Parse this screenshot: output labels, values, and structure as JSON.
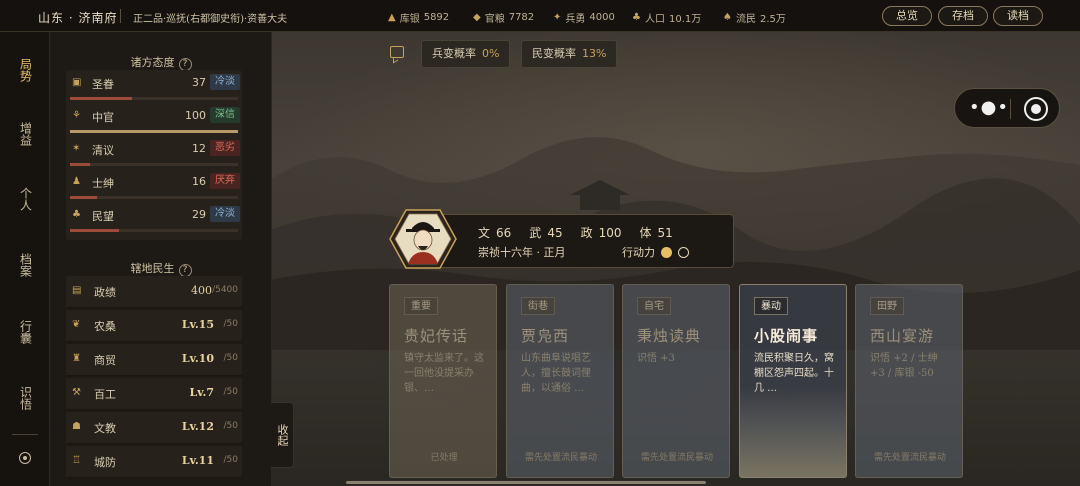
{
  "topbar": {
    "location": "山东 · 济南府",
    "rank": "正二品·巡抚(右都御史衔)·资善大夫",
    "stats": [
      {
        "icon": "treasury-icon",
        "label": "库银",
        "value": "5892"
      },
      {
        "icon": "grain-icon",
        "label": "官粮",
        "value": "7782"
      },
      {
        "icon": "soldier-icon",
        "label": "兵勇",
        "value": "4000"
      },
      {
        "icon": "population-icon",
        "label": "人口",
        "value": "10.1万"
      },
      {
        "icon": "refugee-icon",
        "label": "流民",
        "value": "2.5万"
      }
    ],
    "buttons": {
      "overview": "总览",
      "save": "存档",
      "load": "读档"
    }
  },
  "nav": {
    "items": [
      "局势",
      "增益",
      "个人",
      "档案",
      "行囊",
      "识悟"
    ]
  },
  "attitudes": {
    "title": "诸方态度",
    "help": "?",
    "rows": [
      {
        "icon": "emperor-icon",
        "name": "圣眷",
        "value": "37",
        "tag": "冷淡",
        "level": 0.37
      },
      {
        "icon": "palace-icon",
        "name": "中官",
        "value": "100",
        "tag": "深信",
        "level": 1.0
      },
      {
        "icon": "scholar-icon",
        "name": "清议",
        "value": "12",
        "tag": "恶劣",
        "level": 0.12
      },
      {
        "icon": "gentry-icon",
        "name": "士绅",
        "value": "16",
        "tag": "厌弃",
        "level": 0.16
      },
      {
        "icon": "people-icon",
        "name": "民望",
        "value": "29",
        "tag": "冷淡",
        "level": 0.29
      }
    ]
  },
  "governance": {
    "title": "辖地民生",
    "help": "?",
    "rows": [
      {
        "icon": "merit-icon",
        "name": "政绩",
        "value": "400",
        "max": "/5400"
      },
      {
        "icon": "farm-icon",
        "name": "农桑",
        "value": "Lv.15",
        "max": "/50"
      },
      {
        "icon": "trade-icon",
        "name": "商贸",
        "value": "Lv.10",
        "max": "/50"
      },
      {
        "icon": "craft-icon",
        "name": "百工",
        "value": "Lv.7",
        "max": "/50"
      },
      {
        "icon": "culture-icon",
        "name": "文教",
        "value": "Lv.12",
        "max": "/50"
      },
      {
        "icon": "defense-icon",
        "name": "城防",
        "value": "Lv.11",
        "max": "/50"
      }
    ]
  },
  "collapse_label": "收起",
  "chips": {
    "mutiny": {
      "label": "兵变概率",
      "value": "0%"
    },
    "revolt": {
      "label": "民变概率",
      "value": "13%"
    }
  },
  "character": {
    "attrs": [
      {
        "label": "文",
        "value": "66"
      },
      {
        "label": "武",
        "value": "45"
      },
      {
        "label": "政",
        "value": "100"
      },
      {
        "label": "体",
        "value": "51"
      }
    ],
    "date": "崇祯十六年 · 正月",
    "action_label": "行动力",
    "action_points": 1,
    "action_max": 2
  },
  "events": [
    {
      "tag": "重要",
      "title": "贵妃传话",
      "desc": "镇守太监来了。这一回他没提采办银、…",
      "foot": "已处理",
      "style": "brown"
    },
    {
      "tag": "街巷",
      "title": "贾凫西",
      "desc": "山东曲阜说唱艺人，擅长鼓词俚曲，以通俗 …",
      "foot": "需先处置流民暴动",
      "style": "blue"
    },
    {
      "tag": "自宅",
      "title": "秉烛读典",
      "desc": "识悟 +3",
      "foot": "需先处置流民暴动",
      "style": "blue"
    },
    {
      "tag": "暴动",
      "title": "小股闹事",
      "desc": "流民积聚日久，窝棚区怨声四起。十几 …",
      "foot": "",
      "style": "active"
    },
    {
      "tag": "田野",
      "title": "西山宴游",
      "desc": "识悟 +2 / 士绅 +3 / 库银 -50",
      "foot": "需先处置流民暴动",
      "style": "blue"
    }
  ]
}
